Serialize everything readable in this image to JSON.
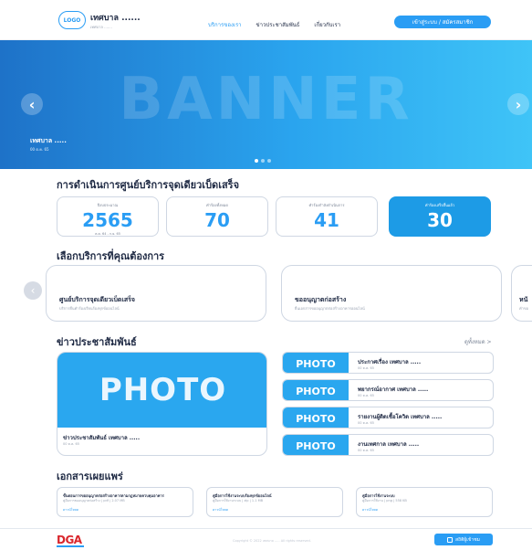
{
  "header": {
    "logo": "LOGO",
    "brand_name": "เทศบาล ......",
    "brand_sub": "เทศบาล .......",
    "nav": [
      "บริการของเรา",
      "ข่าวประชาสัมพันธ์",
      "เกี่ยวกับเรา"
    ],
    "login_label": "เข้าสู่ระบบ / สมัครสมาชิก"
  },
  "banner": {
    "text": "BANNER",
    "caption_title": "เทศบาล .....",
    "caption_date": "00 ต.ค. 65",
    "prev_icon": "chevron-left-icon",
    "next_icon": "chevron-right-icon"
  },
  "operations": {
    "title": "การดำเนินการศูนย์บริการจุดเดียวเบ็ดเสร็จ",
    "stats": [
      {
        "label": "ปีงบประมาณ",
        "value": "2565",
        "sub": "ต.ค. 64 - ก.ย. 65"
      },
      {
        "label": "คำร้องทั้งหมด",
        "value": "70",
        "sub": ""
      },
      {
        "label": "คำร้องกำลังดำเนินการ",
        "value": "41",
        "sub": ""
      },
      {
        "label": "คำร้องเสร็จสิ้นแล้ว",
        "value": "30",
        "sub": ""
      }
    ]
  },
  "services": {
    "title": "เลือกบริการที่คุณต้องการ",
    "cards": [
      {
        "name": "ศูนย์บริการจุดเดียวเบ็ดเสร็จ",
        "desc": "บริการยื่นคำร้องเรียนร้องทุกข์ออนไลน์"
      },
      {
        "name": "ขออนุญาตก่อสร้าง",
        "desc": "ยื่นเอกสารขออนุญาตก่อสร้างอาคารออนไลน์"
      },
      {
        "name": "หนั",
        "desc": "คำขอ"
      }
    ]
  },
  "news": {
    "title": "ข่าวประชาสัมพันธ์",
    "see_all": "ดูทั้งหมด >",
    "main": {
      "photo": "PHOTO",
      "title": "ข่าวประชาสัมพันธ์ เทศบาล .....",
      "date": "00 ต.ค. 65"
    },
    "items": [
      {
        "photo": "PHOTO",
        "title": "ประกาศเรื่อง เทศบาล .....",
        "date": "00 ต.ค. 65"
      },
      {
        "photo": "PHOTO",
        "title": "พยากรณ์อากาศ เทศบาล .....",
        "date": "00 ต.ค. 65"
      },
      {
        "photo": "PHOTO",
        "title": "รายงานผู้ติดเชื้อโควิด เทศบาล .....",
        "date": "00 ต.ค. 65"
      },
      {
        "photo": "PHOTO",
        "title": "งานเทศกาล เทศบาล .....",
        "date": "00 ต.ค. 65"
      }
    ]
  },
  "documents": {
    "title": "เอกสารเผยแพร่",
    "items": [
      {
        "title": "ขั้นตอนการขออนุญาตก่อสร้างอาคารตามกฎหมายควบคุมอาคาร",
        "meta": "คู่มือการขออนุญาตก่อสร้าง | pdf | 2.07 MB",
        "link": "ดาวน์โหลด"
      },
      {
        "title": "คู่มือการใช้งานระบบร้องทุกข์ออนไลน์",
        "meta": "คู่มือการใช้งานระบบ | zip | 1.1 MB",
        "link": "ดาวน์โหลด"
      },
      {
        "title": "คู่มือการใช้งานระบบ",
        "meta": "คู่มือการใช้งาน | png | 558 KB",
        "link": "ดาวน์โหลด"
      }
    ]
  },
  "footer": {
    "logo": "DGA",
    "copyright": "Copyright © 2022 เทศบาล ..... All rights reserved.",
    "stat_button": "สถิติผู้เข้าชม"
  },
  "colors": {
    "primary": "#2a9df4",
    "banner_start": "#1e72c8",
    "banner_end": "#3fc4f7",
    "dga_red": "#d9262c"
  }
}
